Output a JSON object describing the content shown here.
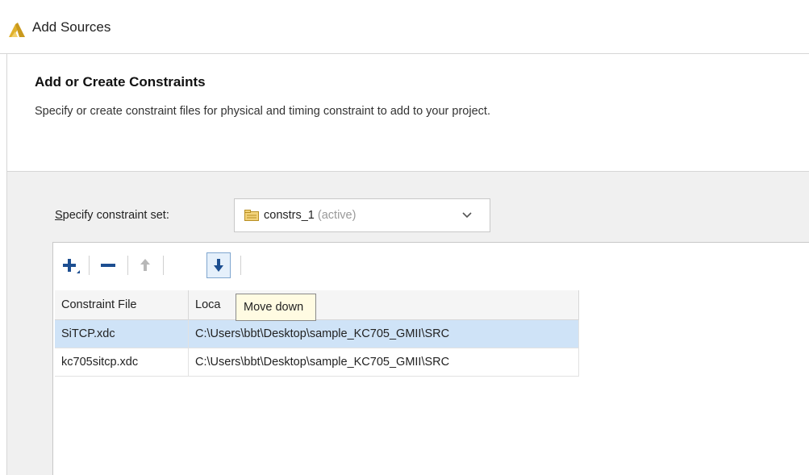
{
  "window": {
    "title": "Add Sources"
  },
  "header": {
    "title": "Add or Create Constraints",
    "subtitle": "Specify or create constraint files for physical and timing constraint to add to your project."
  },
  "constraint_set": {
    "label_mnemonic": "S",
    "label_rest": "pecify constraint set:",
    "selected_name": "constrs_1",
    "selected_status": "(active)"
  },
  "table": {
    "columns": [
      "Constraint File",
      "Loca"
    ],
    "rows": [
      {
        "file": "SiTCP.xdc",
        "location": "C:\\Users\\bbt\\Desktop\\sample_KC705_GMII\\SRC"
      },
      {
        "file": "kc705sitcp.xdc",
        "location": "C:\\Users\\bbt\\Desktop\\sample_KC705_GMII\\SRC"
      }
    ]
  },
  "tooltip": {
    "text": "Move down"
  },
  "colors": {
    "accent": "#2f6db3",
    "selection": "#cfe3f7",
    "tooltip_bg": "#fffbe2"
  }
}
